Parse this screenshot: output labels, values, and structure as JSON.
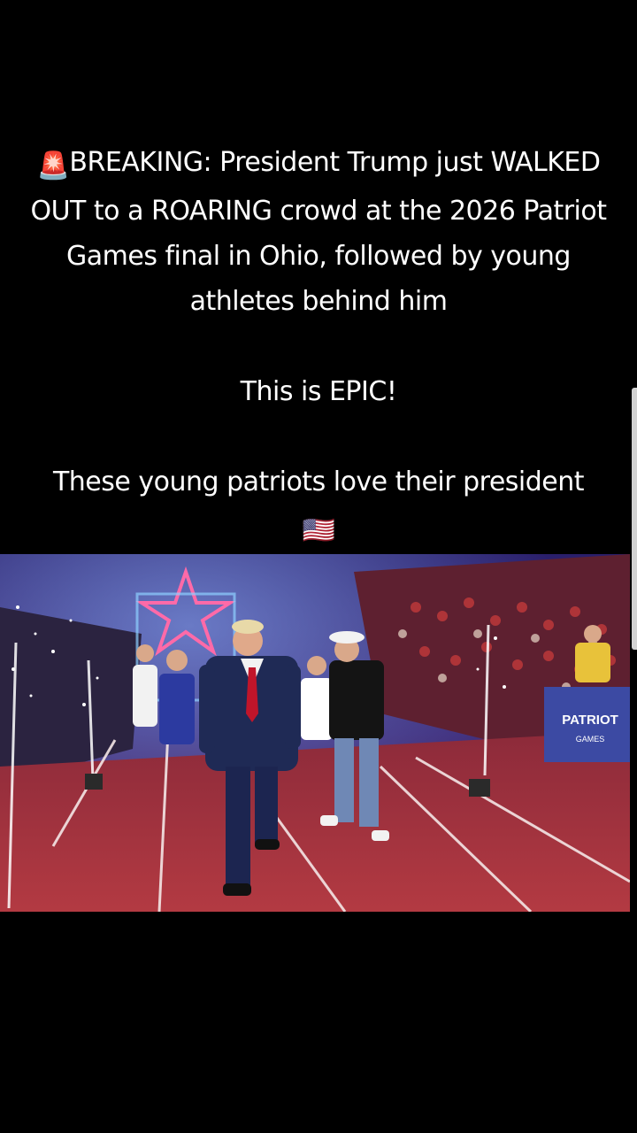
{
  "post": {
    "caption_line_1": "BREAKING: President Trump just WALKED OUT to a ROARING crowd at the 2026 Patriot Games final in Ohio, followed by young athletes behind him",
    "caption_line_2": "This is EPIC!",
    "caption_line_3": "These young patriots love their president",
    "emoji_siren": "🚨",
    "emoji_flag": "🇺🇸"
  },
  "video": {
    "banner_text_1": "PATRIOT",
    "banner_text_2": "GAMES",
    "icon": "video-frame"
  },
  "colors": {
    "background": "#000000",
    "text": "#ffffff",
    "track": "#a8323c",
    "suit": "#1f2a55",
    "tie": "#c0152a"
  }
}
